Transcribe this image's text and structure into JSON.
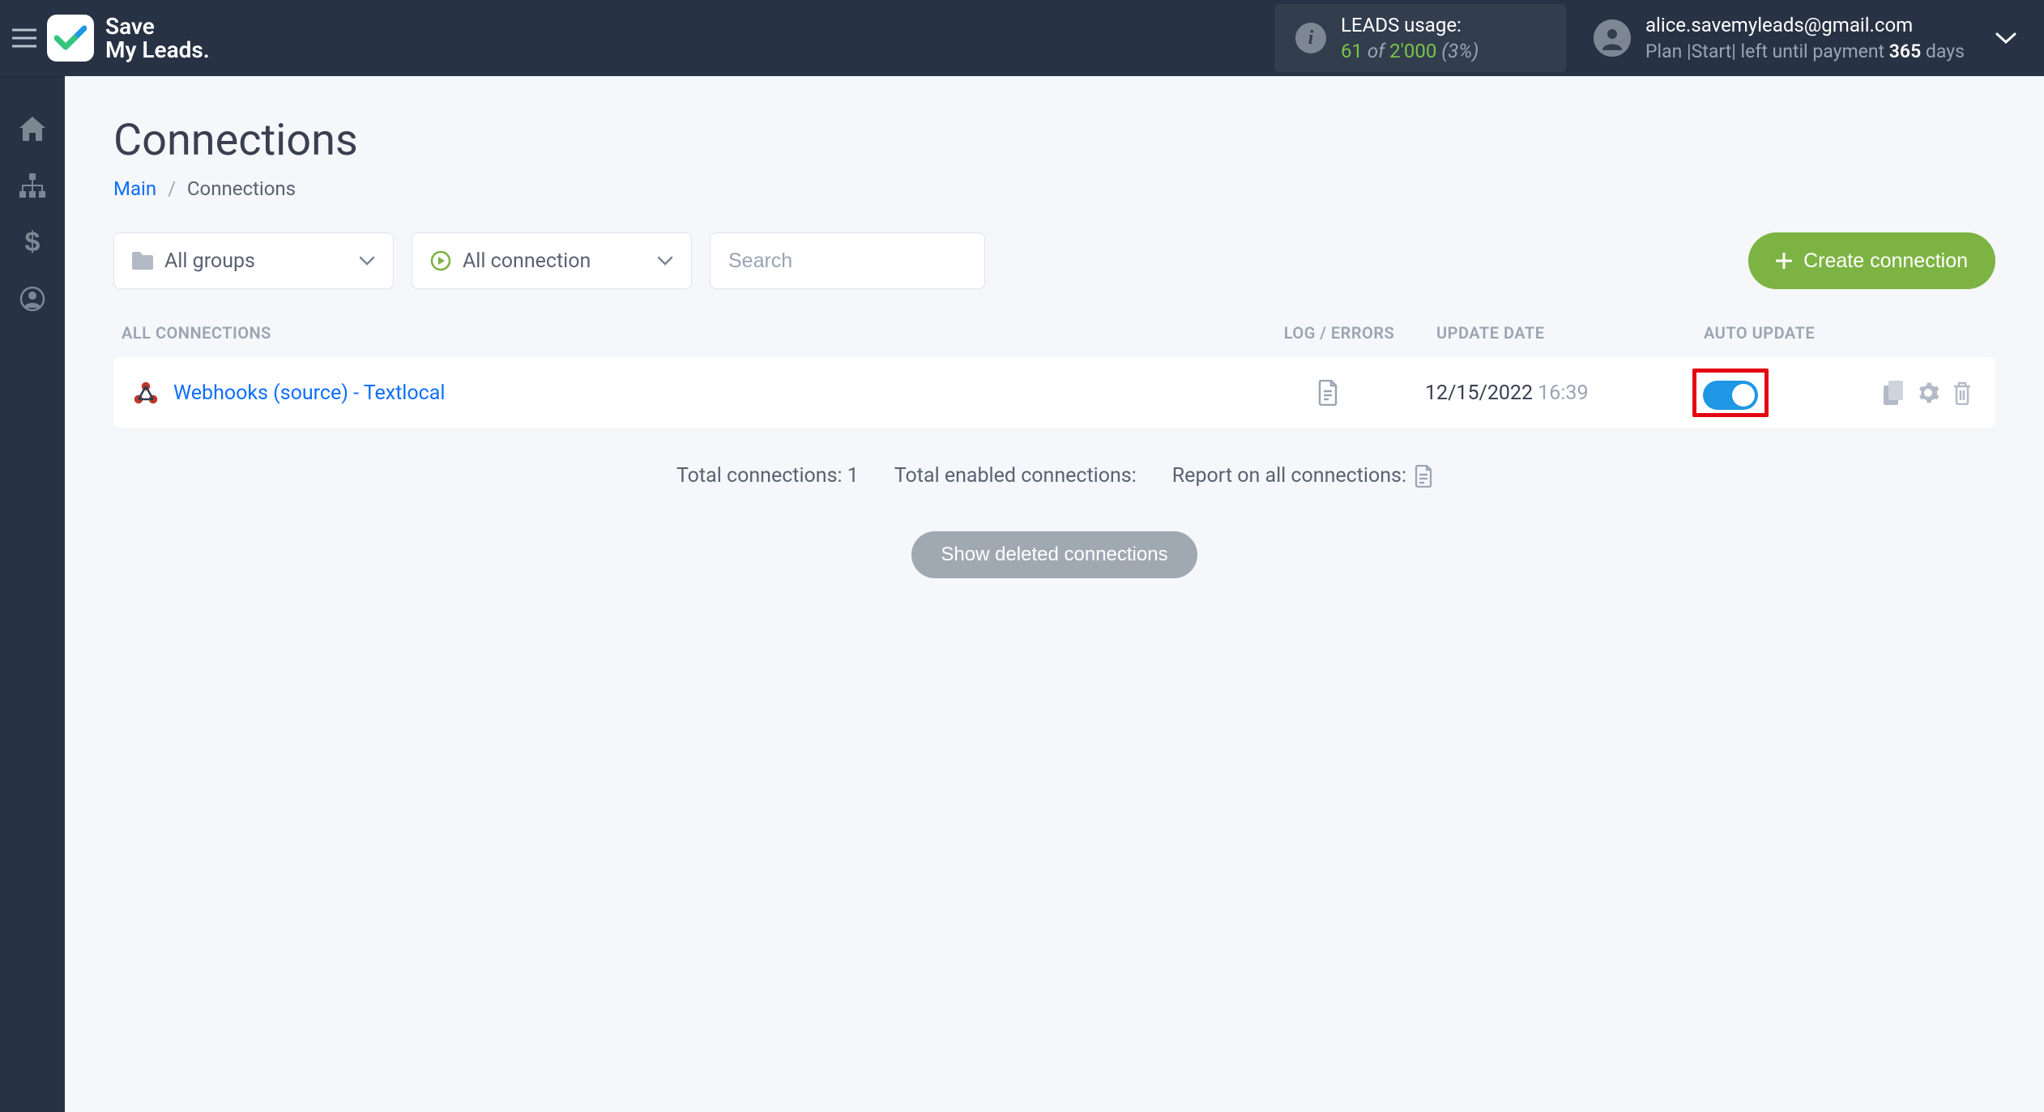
{
  "brand": {
    "line1": "Save",
    "line2": "My Leads"
  },
  "usage": {
    "label": "LEADS usage:",
    "count": "61",
    "of": " of ",
    "limit": "2'000",
    "pct": " (3%)"
  },
  "account": {
    "email": "alice.savemyleads@gmail.com",
    "plan_prefix": "Plan |",
    "plan_name": "Start",
    "plan_mid": "| left until payment ",
    "days": "365",
    "days_suffix": " days"
  },
  "page": {
    "title": "Connections",
    "breadcrumb": {
      "main": "Main",
      "sep": "/",
      "current": "Connections"
    }
  },
  "filters": {
    "groups": "All groups",
    "status": "All connection",
    "search_placeholder": "Search"
  },
  "create_btn": "Create connection",
  "table": {
    "headers": {
      "all": "All connections",
      "log": "Log / Errors",
      "date": "Update date",
      "auto": "Auto update"
    },
    "row": {
      "name": "Webhooks (source) - Textlocal",
      "date": "12/15/2022",
      "time": "16:39"
    }
  },
  "summary": {
    "total": "Total connections: 1",
    "enabled": "Total enabled connections:",
    "report": "Report on all connections:"
  },
  "show_deleted": "Show deleted connections"
}
